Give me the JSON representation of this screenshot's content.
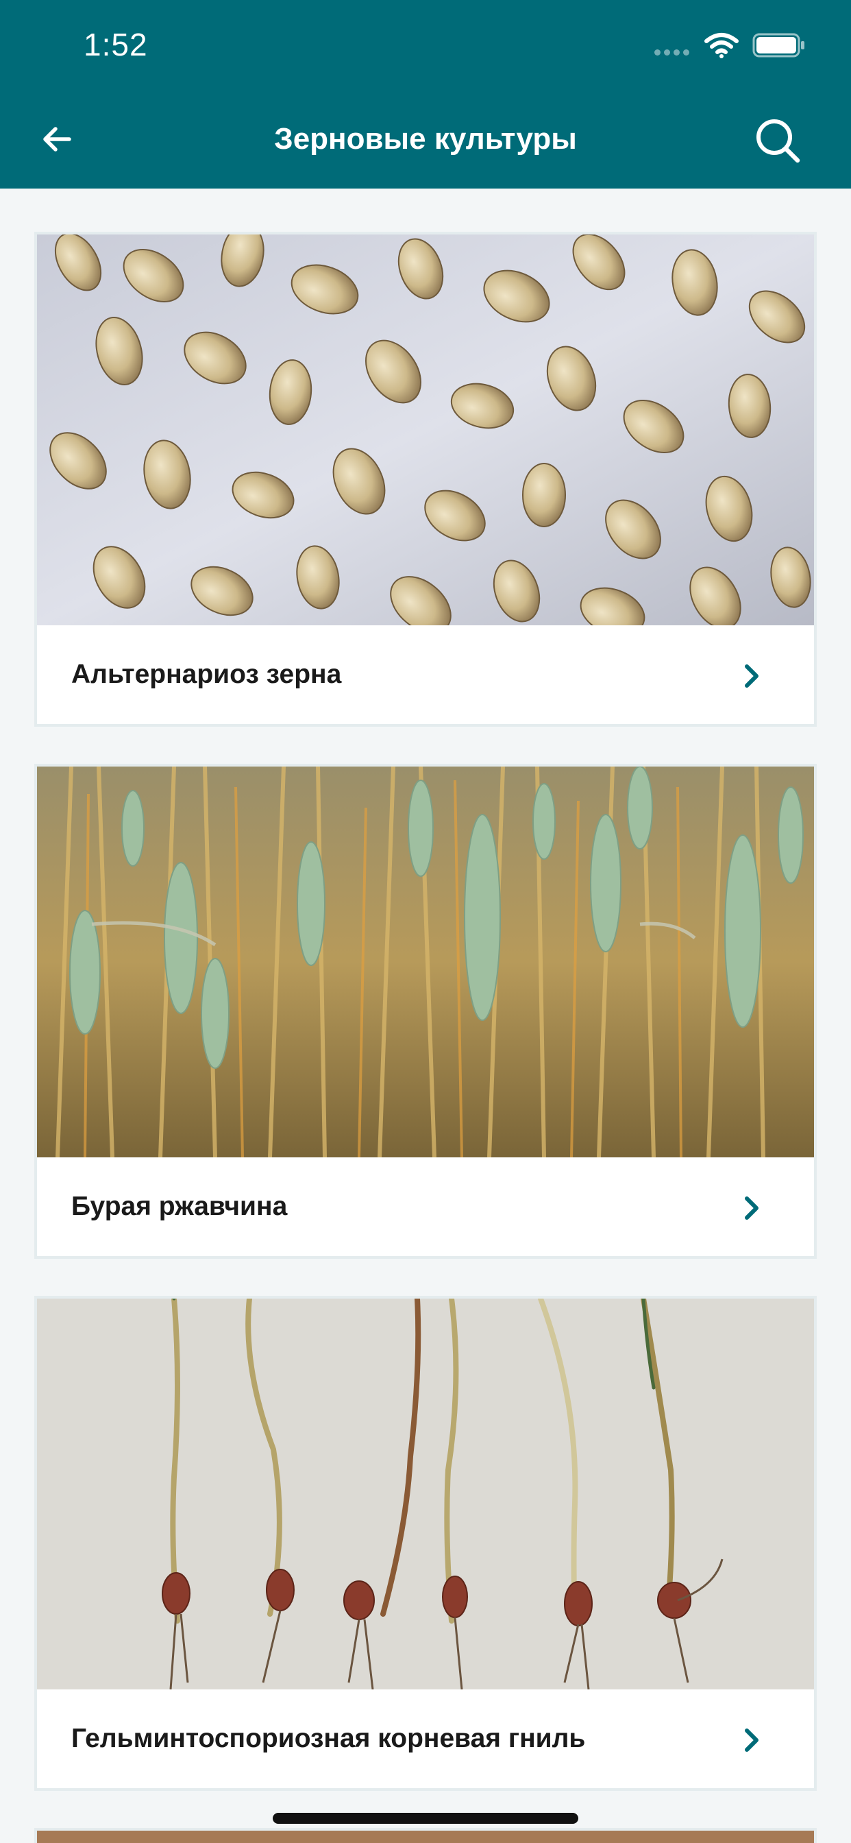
{
  "status_bar": {
    "time": "1:52"
  },
  "header": {
    "title": "Зерновые культуры"
  },
  "colors": {
    "primary": "#006b78",
    "accent_chevron": "#006b78",
    "background": "#f3f6f7"
  },
  "icons": {
    "back": "arrow-left-icon",
    "search": "search-icon",
    "chevron": "chevron-right-icon"
  },
  "items": [
    {
      "label": "Альтернариоз зерна",
      "image": "wheat-grains-photo"
    },
    {
      "label": "Бурая ржавчина",
      "image": "wheat-field-photo"
    },
    {
      "label": "Гельминтоспориозная корневая гниль",
      "image": "wheat-seedlings-roots-photo"
    }
  ]
}
